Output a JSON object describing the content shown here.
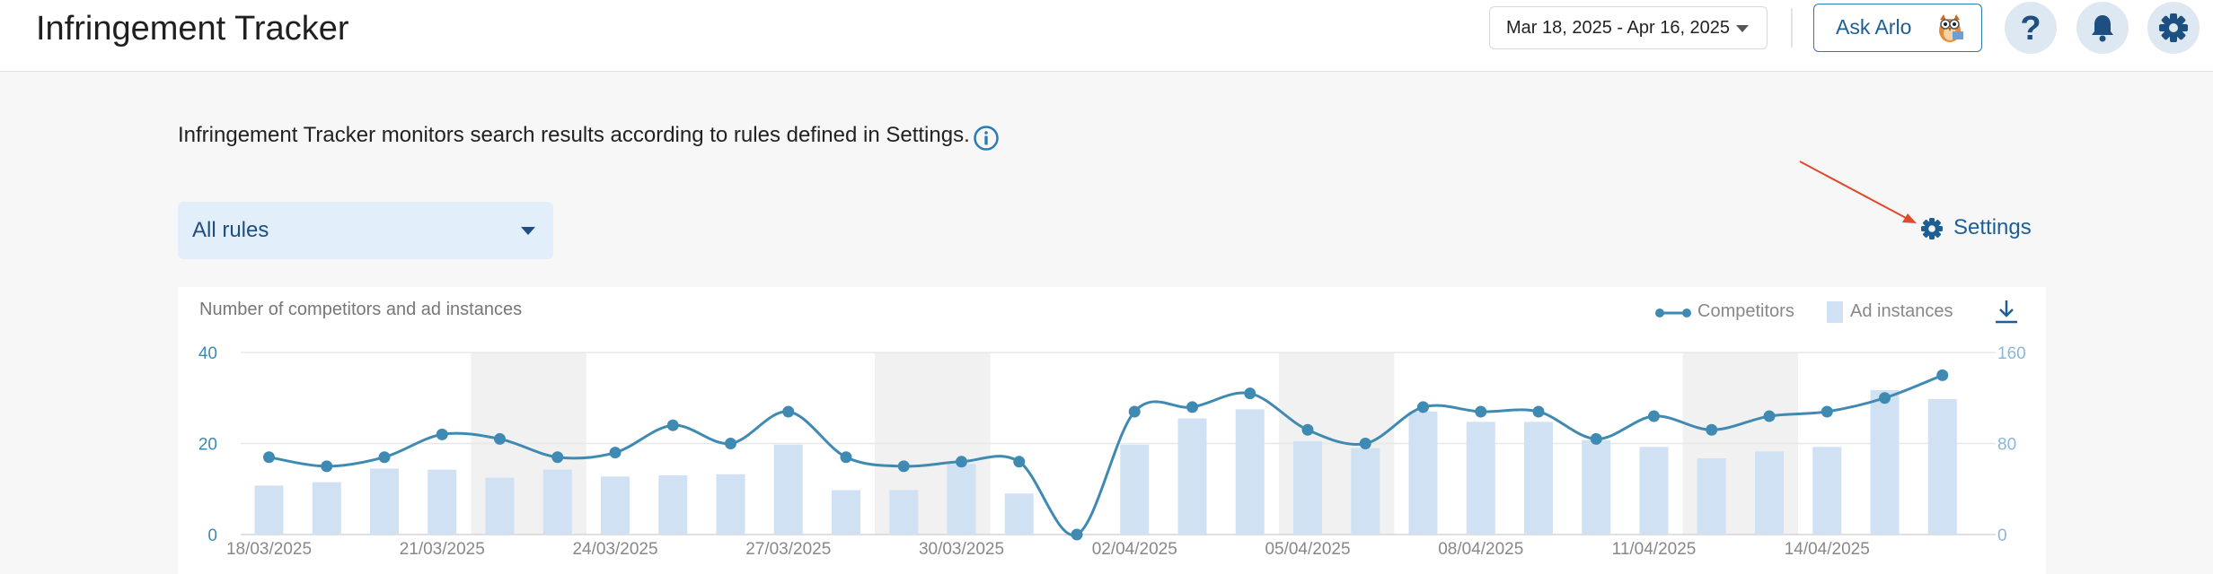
{
  "header": {
    "title": "Infringement Tracker",
    "date_range": "Mar 18, 2025 - Apr 16, 2025",
    "ask_label": "Ask Arlo",
    "icons": [
      "help-icon",
      "bell-icon",
      "gear-icon"
    ]
  },
  "intro": {
    "text": "Infringement Tracker monitors search results according to rules defined in Settings."
  },
  "filters": {
    "rule_select": "All rules"
  },
  "settings_link": {
    "label": "Settings"
  },
  "colors": {
    "line": "#3f8ab2",
    "bar": "#d0e1f4",
    "weekend": "#f1f1f1",
    "accent": "#1d5f94",
    "arrow": "#e04a2c"
  },
  "chart_data": {
    "type": "bar+line",
    "subtitle": "Number of competitors and ad instances",
    "legend": [
      {
        "name": "Competitors",
        "type": "line"
      },
      {
        "name": "Ad instances",
        "type": "bar"
      }
    ],
    "x": [
      "18/03/2025",
      "19/03/2025",
      "20/03/2025",
      "21/03/2025",
      "22/03/2025",
      "23/03/2025",
      "24/03/2025",
      "25/03/2025",
      "26/03/2025",
      "27/03/2025",
      "28/03/2025",
      "29/03/2025",
      "30/03/2025",
      "31/03/2025",
      "01/04/2025",
      "02/04/2025",
      "03/04/2025",
      "04/04/2025",
      "05/04/2025",
      "06/04/2025",
      "07/04/2025",
      "08/04/2025",
      "09/04/2025",
      "10/04/2025",
      "11/04/2025",
      "12/04/2025",
      "13/04/2025",
      "14/04/2025",
      "15/04/2025",
      "16/04/2025"
    ],
    "x_tick_labels": [
      "18/03/2025",
      "21/03/2025",
      "24/03/2025",
      "27/03/2025",
      "30/03/2025",
      "02/04/2025",
      "05/04/2025",
      "08/04/2025",
      "11/04/2025",
      "14/04/2025"
    ],
    "x_tick_indices": [
      0,
      3,
      6,
      9,
      12,
      15,
      18,
      21,
      24,
      27
    ],
    "series": [
      {
        "name": "Competitors",
        "axis": "left",
        "values": [
          17,
          15,
          17,
          22,
          21,
          17,
          18,
          24,
          20,
          27,
          17,
          15,
          16,
          16,
          0,
          27,
          28,
          31,
          23,
          20,
          28,
          27,
          27,
          21,
          26,
          23,
          26,
          27,
          30,
          35
        ]
      },
      {
        "name": "Ad instances",
        "axis": "right",
        "values": [
          43,
          46,
          58,
          57,
          50,
          57,
          51,
          52,
          53,
          79,
          39,
          39,
          62,
          36,
          0,
          79,
          102,
          110,
          82,
          76,
          108,
          99,
          99,
          83,
          77,
          67,
          73,
          77,
          127,
          119
        ]
      }
    ],
    "left_axis": {
      "ticks": [
        0,
        20,
        40
      ],
      "ylim": [
        0,
        40
      ]
    },
    "right_axis": {
      "ticks": [
        0,
        80,
        160
      ],
      "ylim": [
        0,
        160
      ]
    },
    "weekend_bands": [
      [
        4,
        5
      ],
      [
        11,
        12
      ],
      [
        18,
        19
      ],
      [
        25,
        26
      ]
    ],
    "grid": true,
    "legend_position": "top-right"
  }
}
